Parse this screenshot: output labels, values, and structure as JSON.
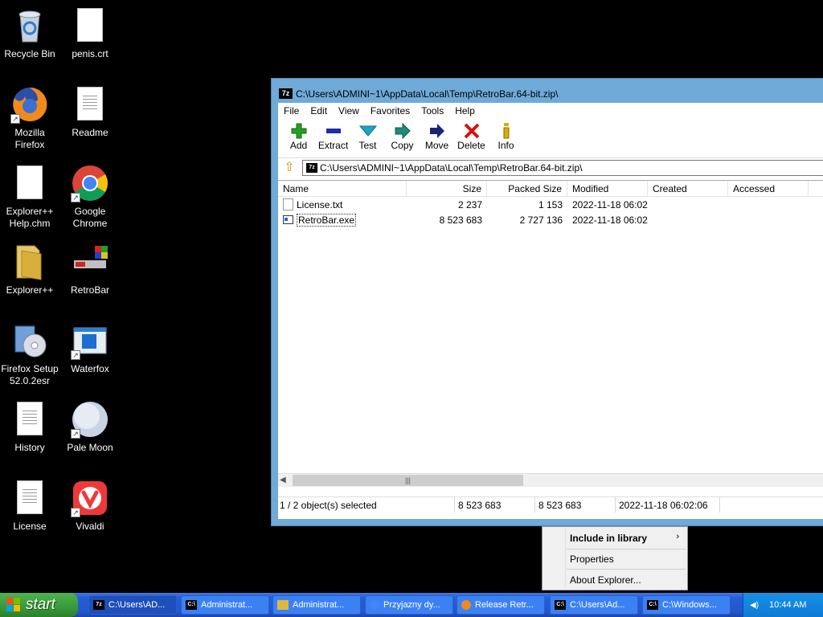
{
  "desktop": {
    "icons": [
      {
        "label": "Recycle Bin",
        "icon": "recycle-bin-icon"
      },
      {
        "label": "penis.crt",
        "icon": "file-icon"
      },
      {
        "label": "Mozilla Firefox",
        "icon": "firefox-icon"
      },
      {
        "label": "Readme",
        "icon": "text-file-icon"
      },
      {
        "label": "Explorer++ Help.chm",
        "icon": "file-icon"
      },
      {
        "label": "Google Chrome",
        "icon": "chrome-icon"
      },
      {
        "label": "Explorer++",
        "icon": "folder-icon"
      },
      {
        "label": "RetroBar",
        "icon": "retrobar-icon"
      },
      {
        "label": "Firefox Setup 52.0.2esr",
        "icon": "installer-icon"
      },
      {
        "label": "Waterfox",
        "icon": "waterfox-icon"
      },
      {
        "label": "History",
        "icon": "text-file-icon"
      },
      {
        "label": "Pale Moon",
        "icon": "pale-moon-icon"
      },
      {
        "label": "License",
        "icon": "text-file-icon"
      },
      {
        "label": "Vivaldi",
        "icon": "vivaldi-icon"
      }
    ]
  },
  "window": {
    "app_icon": "7z",
    "title": "C:\\Users\\ADMINI~1\\AppData\\Local\\Temp\\RetroBar.64-bit.zip\\",
    "menu": [
      "File",
      "Edit",
      "View",
      "Favorites",
      "Tools",
      "Help"
    ],
    "toolbar": [
      {
        "label": "Add",
        "icon": "add-icon",
        "color": "#22a022"
      },
      {
        "label": "Extract",
        "icon": "extract-icon",
        "color": "#1a2fa8"
      },
      {
        "label": "Test",
        "icon": "test-icon",
        "color": "#1aa6c8"
      },
      {
        "label": "Copy",
        "icon": "copy-icon",
        "color": "#1f8a7a"
      },
      {
        "label": "Move",
        "icon": "move-icon",
        "color": "#1a237a"
      },
      {
        "label": "Delete",
        "icon": "delete-icon",
        "color": "#d81010"
      },
      {
        "label": "Info",
        "icon": "info-icon",
        "color": "#d8b000"
      }
    ],
    "address": "C:\\Users\\ADMINI~1\\AppData\\Local\\Temp\\RetroBar.64-bit.zip\\",
    "columns": [
      "Name",
      "Size",
      "Packed Size",
      "Modified",
      "Created",
      "Accessed"
    ],
    "files": [
      {
        "name": "License.txt",
        "size": "2 237",
        "packed": "1 153",
        "modified": "2022-11-18 06:02",
        "created": "",
        "accessed": "",
        "selected": false
      },
      {
        "name": "RetroBar.exe",
        "size": "8 523 683",
        "packed": "2 727 136",
        "modified": "2022-11-18 06:02",
        "created": "",
        "accessed": "",
        "selected": true
      }
    ],
    "status": {
      "selection": "1 / 2 object(s) selected",
      "size": "8 523 683",
      "packed": "8 523 683",
      "modified": "2022-11-18 06:02:06"
    }
  },
  "context_menu": {
    "items": [
      "Include in library",
      "Properties",
      "About Explorer..."
    ]
  },
  "taskbar": {
    "start_label": "start",
    "items": [
      {
        "label": "C:\\Users\\AD...",
        "icon": "7zip-icon"
      },
      {
        "label": "Administrat...",
        "icon": "console-icon"
      },
      {
        "label": "Administrat...",
        "icon": "folder-icon"
      },
      {
        "label": "Przyjazny dy...",
        "icon": "chrome-icon"
      },
      {
        "label": "Release Retr...",
        "icon": "firefox-icon"
      },
      {
        "label": "C:\\Users\\Ad...",
        "icon": "console-icon"
      },
      {
        "label": "C:\\Windows...",
        "icon": "console-icon"
      }
    ],
    "clock": "10:44 AM"
  }
}
